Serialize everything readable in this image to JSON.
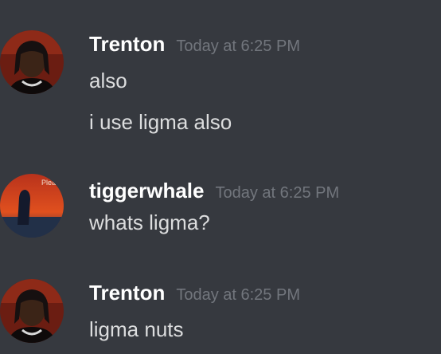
{
  "messages": [
    {
      "author": "Trenton",
      "timestamp": "Today at 6:25 PM",
      "avatar_icon": "avatar-trenton",
      "lines": [
        "also",
        "i use ligma also"
      ]
    },
    {
      "author": "tiggerwhale",
      "timestamp": "Today at 6:25 PM",
      "avatar_icon": "avatar-tiggerwhale",
      "lines": [
        "whats ligma?"
      ]
    },
    {
      "author": "Trenton",
      "timestamp": "Today at 6:25 PM",
      "avatar_icon": "avatar-trenton",
      "lines": [
        "ligma nuts"
      ]
    }
  ],
  "colors": {
    "background": "#36393f",
    "username": "#ffffff",
    "message_text": "#dcddde",
    "timestamp": "#72767d"
  }
}
